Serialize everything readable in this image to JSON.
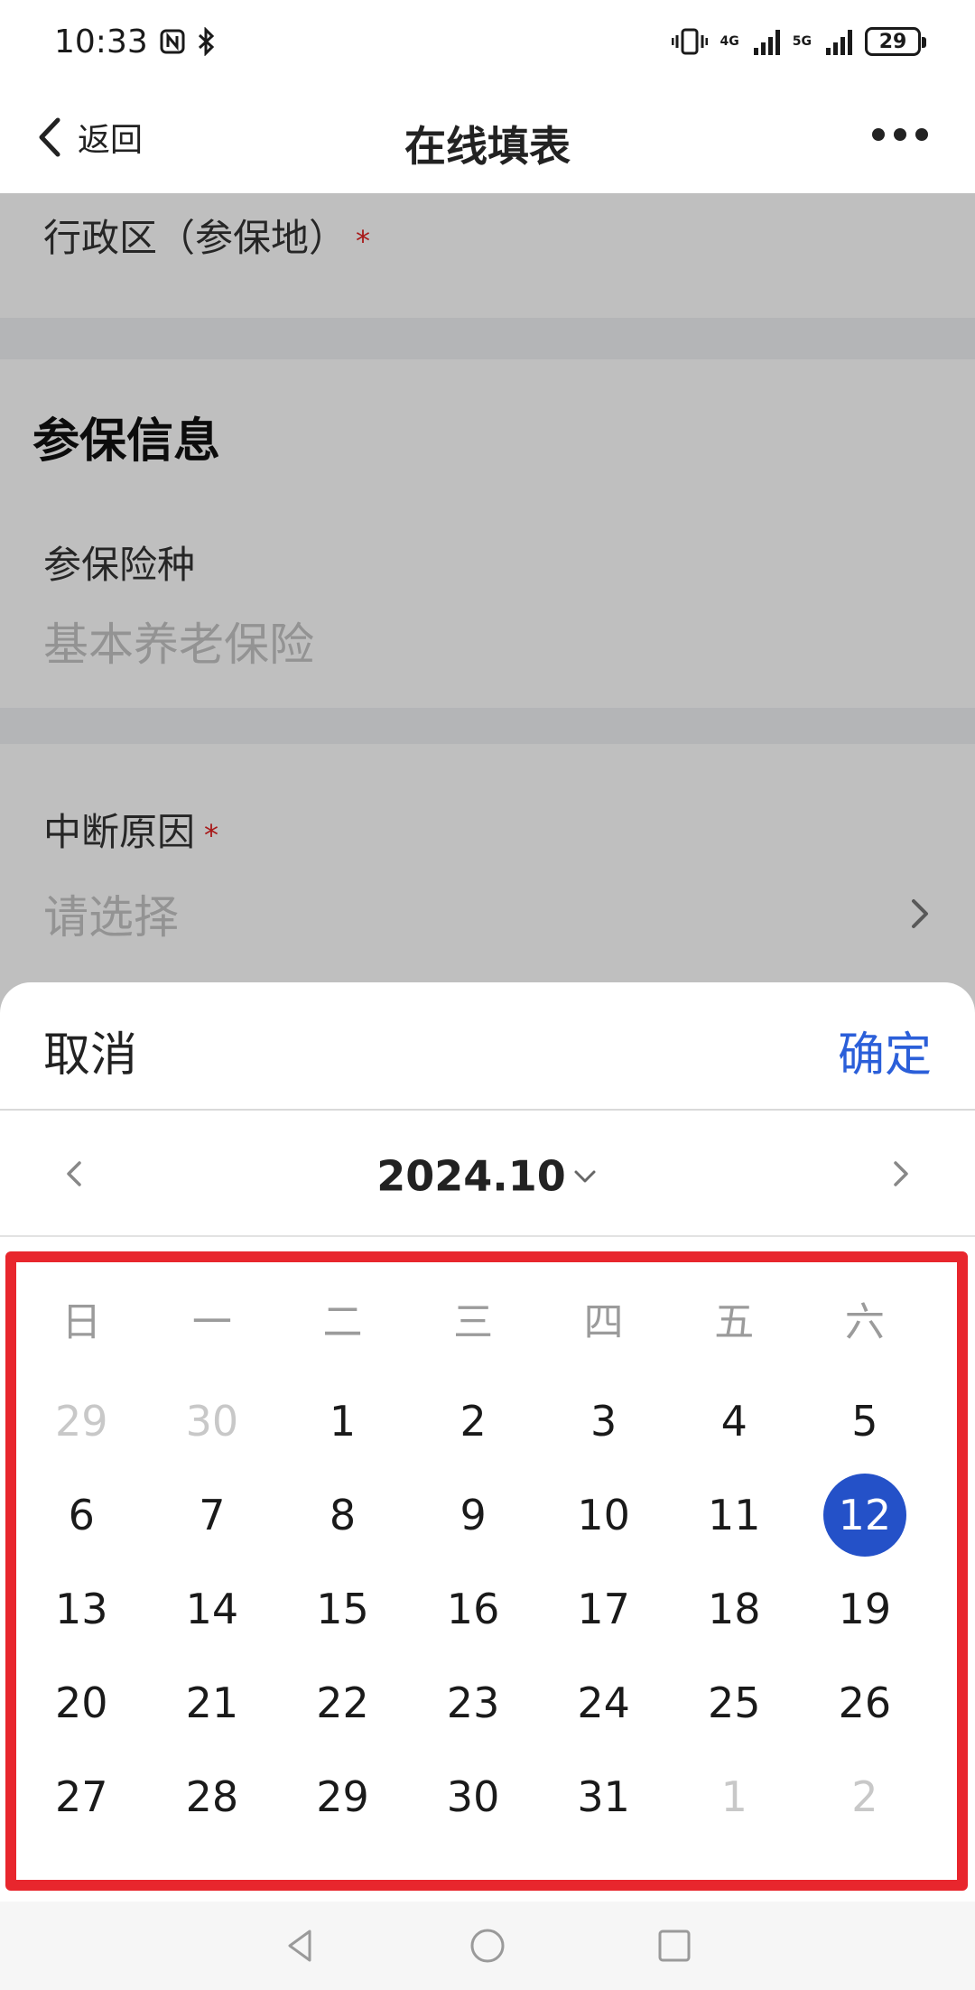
{
  "status_bar": {
    "time": "10:33",
    "battery": "29",
    "net1": "4G",
    "net2": "5G",
    "icons": [
      "nfc-icon",
      "bluetooth-icon",
      "vibrate-icon",
      "signal-icon",
      "battery-icon"
    ]
  },
  "header": {
    "back_label": "返回",
    "title": "在线填表",
    "icons": [
      "chevron-left-icon",
      "more-icon"
    ]
  },
  "form": {
    "admin_region_label": "行政区（参保地）",
    "required_mark": "*",
    "section_title": "参保信息",
    "insurance_type_label": "参保险种",
    "insurance_type_value": "基本养老保险",
    "interrupt_reason_label": "中断原因",
    "interrupt_reason_placeholder": "请选择"
  },
  "picker": {
    "cancel_label": "取消",
    "confirm_label": "确定",
    "month_label": "2024.10",
    "accent_color": "#2451c8",
    "weekdays": [
      "日",
      "一",
      "二",
      "三",
      "四",
      "五",
      "六"
    ],
    "weeks": [
      [
        "29",
        "30",
        "1",
        "2",
        "3",
        "4",
        "5"
      ],
      [
        "6",
        "7",
        "8",
        "9",
        "10",
        "11",
        "12"
      ],
      [
        "13",
        "14",
        "15",
        "16",
        "17",
        "18",
        "19"
      ],
      [
        "20",
        "21",
        "22",
        "23",
        "24",
        "25",
        "26"
      ],
      [
        "27",
        "28",
        "29",
        "30",
        "31",
        "1",
        "2"
      ]
    ],
    "selected_day": "12"
  }
}
